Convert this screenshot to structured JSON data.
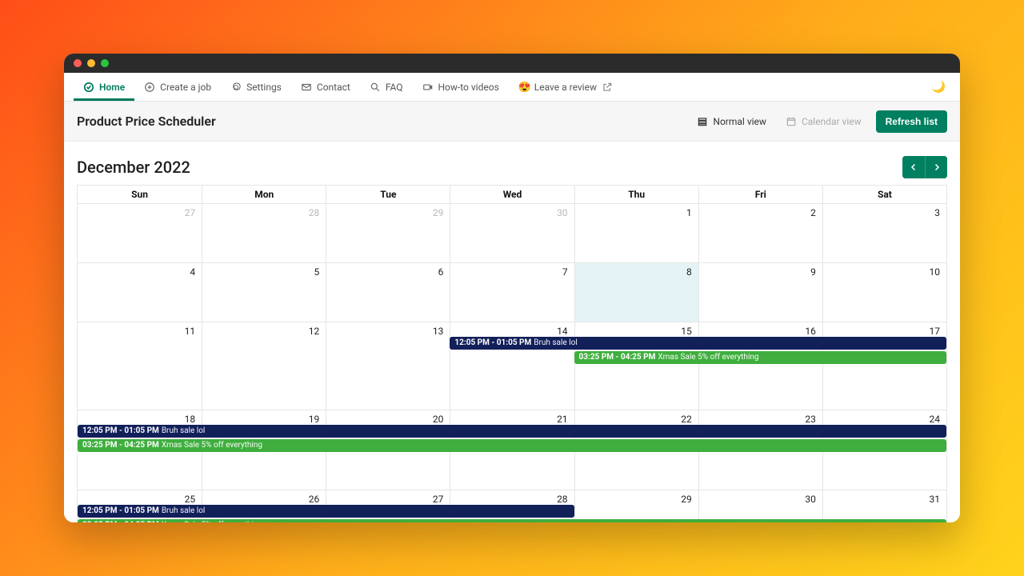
{
  "nav": {
    "home": "Home",
    "create": "Create a job",
    "settings": "Settings",
    "contact": "Contact",
    "faq": "FAQ",
    "howto": "How-to videos",
    "review": "Leave a review"
  },
  "page": {
    "title": "Product Price Scheduler",
    "normal_view": "Normal view",
    "calendar_view": "Calendar view",
    "refresh": "Refresh list"
  },
  "calendar": {
    "title": "December 2022",
    "days": [
      "Sun",
      "Mon",
      "Tue",
      "Wed",
      "Thu",
      "Fri",
      "Sat"
    ],
    "today_index": 11,
    "weeks": [
      {
        "dates": [
          "27",
          "28",
          "29",
          "30",
          "1",
          "2",
          "3"
        ],
        "other": [
          true,
          true,
          true,
          true,
          false,
          false,
          false
        ]
      },
      {
        "dates": [
          "4",
          "5",
          "6",
          "7",
          "8",
          "9",
          "10"
        ]
      },
      {
        "dates": [
          "11",
          "12",
          "13",
          "14",
          "15",
          "16",
          "17"
        ]
      },
      {
        "dates": [
          "18",
          "19",
          "20",
          "21",
          "22",
          "23",
          "24"
        ]
      },
      {
        "dates": [
          "25",
          "26",
          "27",
          "28",
          "29",
          "30",
          "31"
        ]
      }
    ],
    "events": {
      "navy": {
        "time": "12:05 PM - 01:05 PM",
        "label": "Bruh sale lol"
      },
      "green": {
        "time": "03:25 PM - 04:25 PM",
        "label": "Xmas Sale 5% off everything"
      }
    }
  },
  "colors": {
    "accent": "#008060",
    "navy": "#12205a",
    "green": "#3fae3e"
  }
}
